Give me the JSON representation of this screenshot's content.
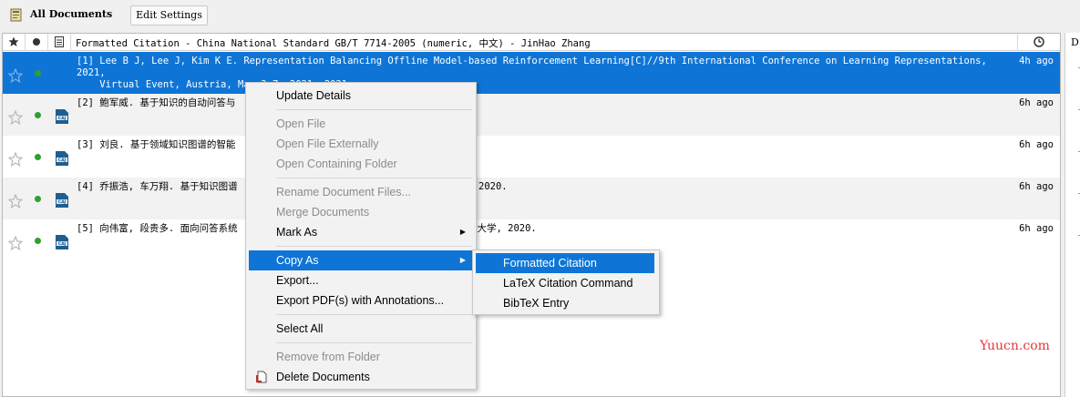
{
  "toolbar": {
    "title": "All Documents",
    "edit_settings": "Edit Settings"
  },
  "table": {
    "header_text": "Formatted Citation - China National Standard GB/T 7714-2005 (numeric, 中文) - JinHao Zhang",
    "rows": [
      {
        "text": "[1] Lee B J, Lee J, Kim K E. Representation Balancing Offline Model-based Reinforcement Learning[C]//9th International Conference on Learning Representations, 2021,\n    Virtual Event, Austria, May 3-7, 2021. 2021.",
        "time": "4h ago",
        "selected": true
      },
      {
        "text": "[2] 鲍军威. 基于知识的自动问答与",
        "time": "6h ago"
      },
      {
        "text": "[3] 刘良. 基于领域知识图谱的智能",
        "time": "6h ago"
      },
      {
        "text": "[4] 乔振浩, 车万翔. 基于知识图谱",
        "text_tail": "2020.",
        "time": "6h ago"
      },
      {
        "text": "[5] 向伟富, 段贵多. 面向问答系统",
        "text_tail": "技大学, 2020.",
        "time": "6h ago"
      }
    ]
  },
  "context_menu": {
    "items": [
      {
        "label": "Update Details",
        "disabled": false
      },
      {
        "label": "Open File",
        "disabled": true
      },
      {
        "label": "Open File Externally",
        "disabled": true
      },
      {
        "label": "Open Containing Folder",
        "disabled": true
      },
      {
        "label": "Rename Document Files...",
        "disabled": true
      },
      {
        "label": "Merge Documents",
        "disabled": true
      },
      {
        "label": "Mark As",
        "disabled": false
      },
      {
        "label": "Copy As",
        "disabled": false
      },
      {
        "label": "Export...",
        "disabled": false
      },
      {
        "label": "Export PDF(s) with Annotations...",
        "disabled": false
      },
      {
        "label": "Select All",
        "disabled": false
      },
      {
        "label": "Remove from Folder",
        "disabled": true
      },
      {
        "label": "Delete Documents",
        "disabled": false
      }
    ]
  },
  "submenu": {
    "items": [
      {
        "label": "Formatted Citation"
      },
      {
        "label": "LaTeX Citation Command"
      },
      {
        "label": "BibTeX Entry"
      }
    ]
  },
  "right_panel": {
    "letter": "D"
  },
  "watermark": "Yuucn.com",
  "colors": {
    "selection": "#0e75d7",
    "read_dot": "#2ea02e"
  }
}
